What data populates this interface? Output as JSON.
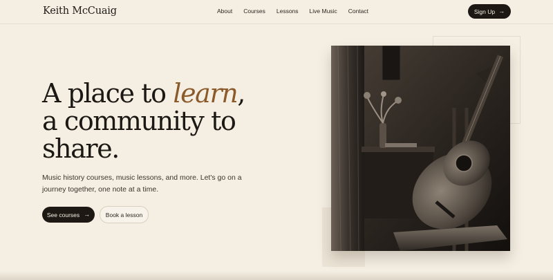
{
  "header": {
    "logo": "Keith McCuaig",
    "nav": [
      "About",
      "Courses",
      "Lessons",
      "Live Music",
      "Contact"
    ],
    "signup_label": "Sign Up",
    "signup_icon": "arrow-right-icon"
  },
  "hero": {
    "headline_part1": "A place to ",
    "headline_accent": "learn",
    "headline_part2": ",",
    "headline_line2": "a community to",
    "headline_line3": "share.",
    "subtext": "Music history courses, music lessons, and more. Let's go on a journey together, one note at a time.",
    "primary_cta": "See courses",
    "primary_cta_icon": "arrow-right-icon",
    "secondary_cta": "Book a lesson"
  },
  "image": {
    "subject": "acoustic-guitar-on-chair-photo"
  },
  "colors": {
    "background": "#f5efe3",
    "accent": "#8b5a2b",
    "button_dark": "#1d1813"
  }
}
